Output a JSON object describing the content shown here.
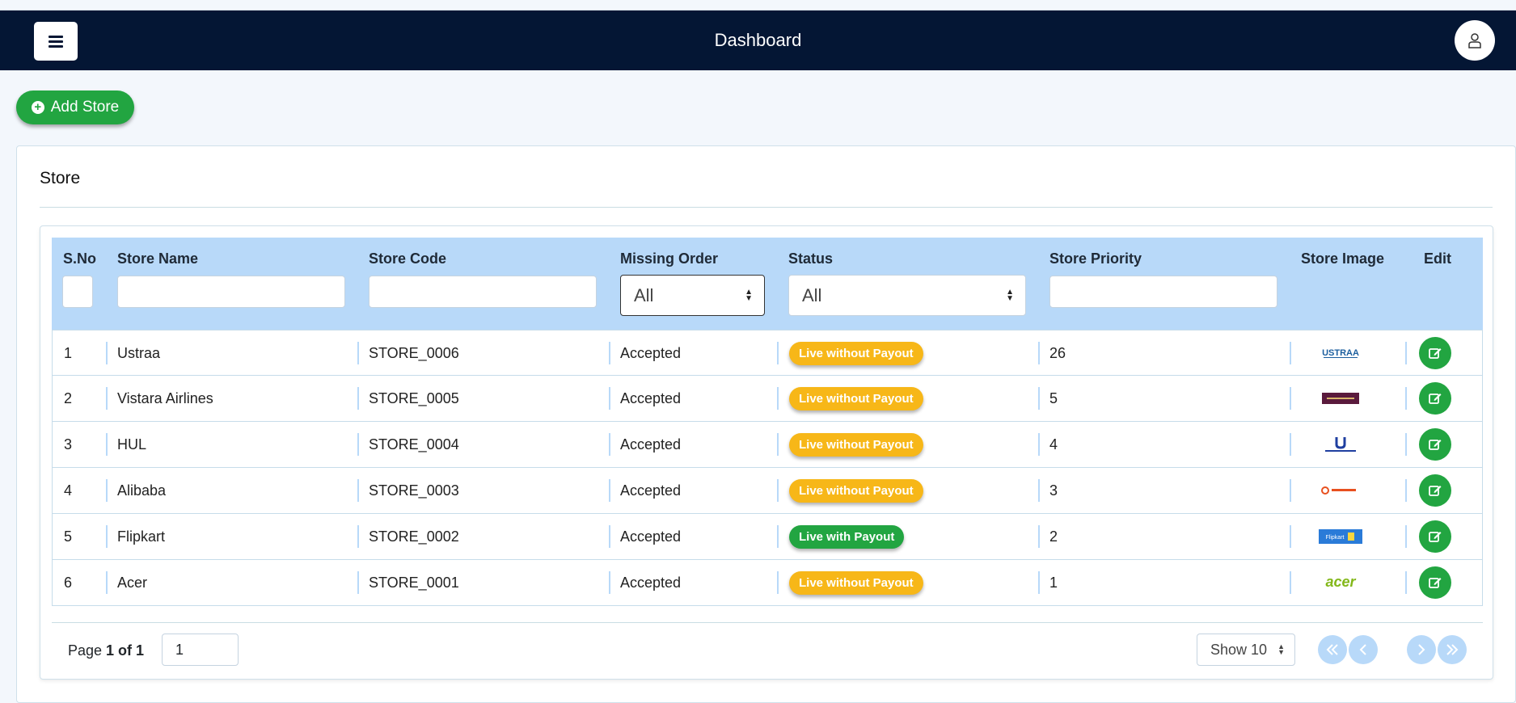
{
  "navbar": {
    "title": "Dashboard"
  },
  "actions": {
    "add_store_label": "Add Store"
  },
  "card": {
    "title": "Store"
  },
  "table": {
    "headers": {
      "sno": "S.No",
      "store_name": "Store Name",
      "store_code": "Store Code",
      "missing_order": "Missing Order",
      "status": "Status",
      "store_priority": "Store Priority",
      "store_image": "Store Image",
      "edit": "Edit"
    },
    "filters": {
      "missing_order_selected": "All",
      "status_selected": "All"
    },
    "rows": [
      {
        "sno": "1",
        "name": "Ustraa",
        "code": "STORE_0006",
        "missing_order": "Accepted",
        "status": "Live without Payout",
        "status_type": "warn",
        "priority": "26",
        "logo": "ustraa-logo"
      },
      {
        "sno": "2",
        "name": "Vistara Airlines",
        "code": "STORE_0005",
        "missing_order": "Accepted",
        "status": "Live without Payout",
        "status_type": "warn",
        "priority": "5",
        "logo": "vistara-logo"
      },
      {
        "sno": "3",
        "name": "HUL",
        "code": "STORE_0004",
        "missing_order": "Accepted",
        "status": "Live without Payout",
        "status_type": "warn",
        "priority": "4",
        "logo": "hul-logo"
      },
      {
        "sno": "4",
        "name": "Alibaba",
        "code": "STORE_0003",
        "missing_order": "Accepted",
        "status": "Live without Payout",
        "status_type": "warn",
        "priority": "3",
        "logo": "alibaba-logo"
      },
      {
        "sno": "5",
        "name": "Flipkart",
        "code": "STORE_0002",
        "missing_order": "Accepted",
        "status": "Live with Payout",
        "status_type": "ok",
        "priority": "2",
        "logo": "flipkart-logo"
      },
      {
        "sno": "6",
        "name": "Acer",
        "code": "STORE_0001",
        "missing_order": "Accepted",
        "status": "Live without Payout",
        "status_type": "warn",
        "priority": "1",
        "logo": "acer-logo"
      }
    ]
  },
  "pagination": {
    "page_prefix": "Page ",
    "page_of": "1 of 1",
    "page_input_value": "1",
    "page_size": "Show 10"
  },
  "logo_text": {
    "ustraa": "USTRAA",
    "acer": "acer",
    "flipkart": "Flipkart"
  },
  "colors": {
    "navbar": "#041634",
    "success": "#22a541",
    "warning": "#f7b718",
    "table_header": "#b8d9f9"
  }
}
